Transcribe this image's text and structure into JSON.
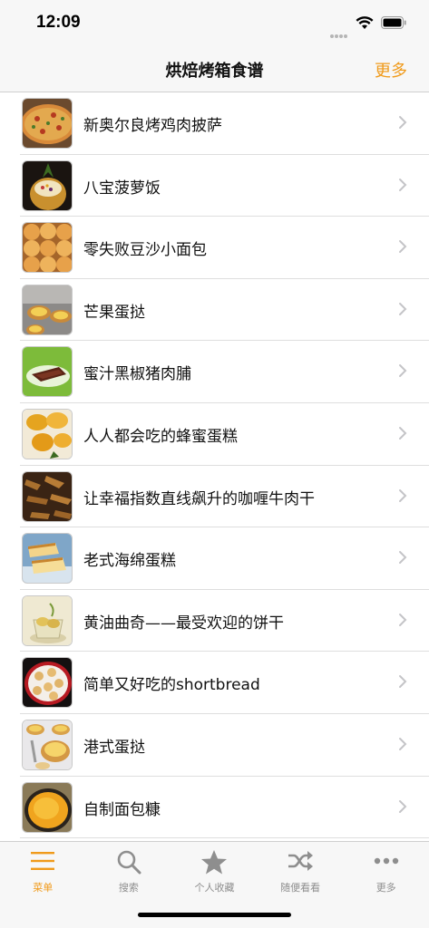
{
  "status_bar": {
    "time": "12:09"
  },
  "nav": {
    "title": "烘焙烤箱食谱",
    "more_label": "更多"
  },
  "colors": {
    "accent": "#f09a1a",
    "inactive": "#8e8e8e"
  },
  "recipes": [
    {
      "title": "新奥尔良烤鸡肉披萨",
      "thumb": "pizza"
    },
    {
      "title": "八宝菠萝饭",
      "thumb": "pineapple-rice"
    },
    {
      "title": "零失败豆沙小面包",
      "thumb": "buns"
    },
    {
      "title": "芒果蛋挞",
      "thumb": "egg-tart"
    },
    {
      "title": "蜜汁黑椒猪肉脯",
      "thumb": "pork-jerky"
    },
    {
      "title": "人人都会吃的蜂蜜蛋糕",
      "thumb": "honey-cake"
    },
    {
      "title": "让幸福指数直线飙升的咖喱牛肉干",
      "thumb": "beef-jerky"
    },
    {
      "title": "老式海绵蛋糕",
      "thumb": "sponge-cake"
    },
    {
      "title": "黄油曲奇——最受欢迎的饼干",
      "thumb": "cookies"
    },
    {
      "title": "简单又好吃的shortbread",
      "thumb": "shortbread"
    },
    {
      "title": "港式蛋挞",
      "thumb": "hk-egg-tart"
    },
    {
      "title": "自制面包糠",
      "thumb": "breadcrumbs"
    }
  ],
  "tabs": [
    {
      "label": "菜单",
      "icon": "menu-icon",
      "active": true
    },
    {
      "label": "搜索",
      "icon": "search-icon",
      "active": false
    },
    {
      "label": "个人收藏",
      "icon": "star-icon",
      "active": false
    },
    {
      "label": "随便看看",
      "icon": "shuffle-icon",
      "active": false
    },
    {
      "label": "更多",
      "icon": "more-dots-icon",
      "active": false
    }
  ]
}
